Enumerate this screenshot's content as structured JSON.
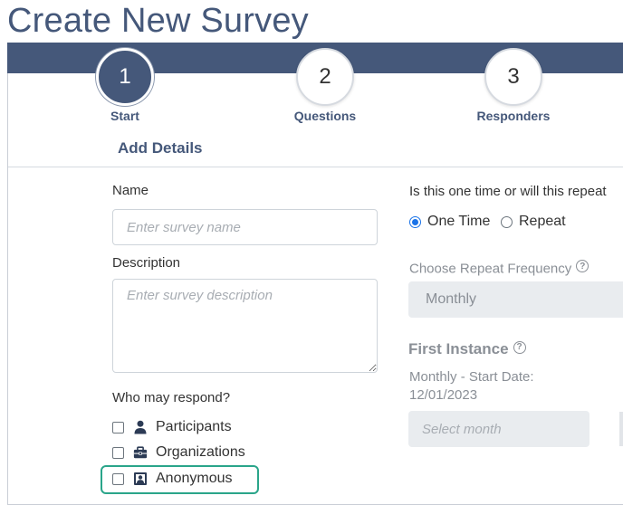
{
  "page": {
    "title": "Create New Survey"
  },
  "steps": [
    {
      "number": "1",
      "label": "Start"
    },
    {
      "number": "2",
      "label": "Questions"
    },
    {
      "number": "3",
      "label": "Responders"
    }
  ],
  "section": {
    "title": "Add Details"
  },
  "form": {
    "name_label": "Name",
    "name_placeholder": "Enter survey name",
    "name_value": "",
    "description_label": "Description",
    "description_placeholder": "Enter survey description",
    "description_value": "",
    "respond_label": "Who may respond?",
    "respond_options": [
      {
        "label": "Participants",
        "icon": "person-icon",
        "checked": false
      },
      {
        "label": "Organizations",
        "icon": "briefcase-icon",
        "checked": false
      },
      {
        "label": "Anonymous",
        "icon": "id-badge-icon",
        "checked": false
      }
    ]
  },
  "repeat": {
    "question": "Is this one time or will this repeat",
    "options": [
      {
        "label": "One Time",
        "checked": true
      },
      {
        "label": "Repeat",
        "checked": false
      }
    ],
    "frequency_label": "Choose Repeat Frequency",
    "frequency_value": "Monthly",
    "help_glyph": "?",
    "first_instance_title": "First Instance",
    "start_date_label": "Monthly - Start Date:",
    "start_date_value": "12/01/2023",
    "month_placeholder": "Select month"
  },
  "colors": {
    "brand": "#45587a",
    "radio_accent": "#1a73e8",
    "highlight": "#2aa58a"
  }
}
